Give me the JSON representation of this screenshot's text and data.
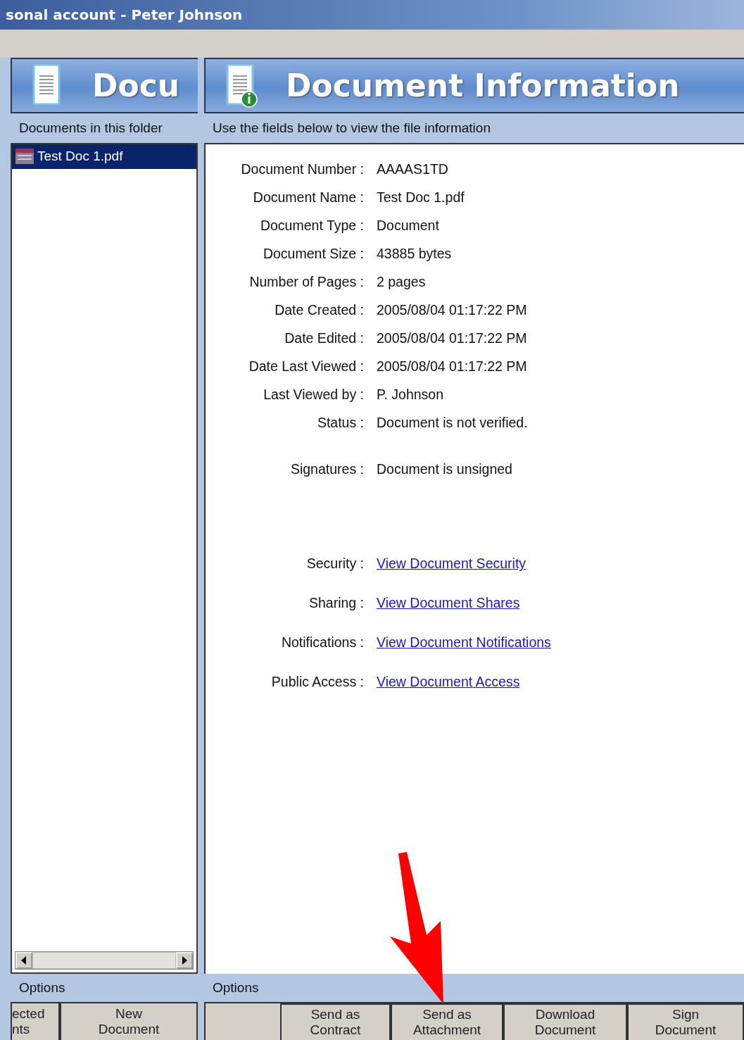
{
  "window": {
    "title": "sonal account - Peter Johnson"
  },
  "left_panel": {
    "header": "Docu",
    "caption": "Documents in this folder",
    "files": [
      {
        "name": "Test Doc 1.pdf",
        "selected": true
      }
    ],
    "options_label": "Options",
    "buttons": [
      {
        "lines": [
          "ected",
          "nts"
        ]
      },
      {
        "lines": [
          "New",
          "Document"
        ]
      }
    ]
  },
  "right_panel": {
    "header": "Document Information",
    "caption": "Use the fields below to view the file information",
    "sections": [
      [
        {
          "label": "Document Number :",
          "value": "AAAAS1TD",
          "kind": "text"
        },
        {
          "label": "Document Name :",
          "value": "Test Doc 1.pdf",
          "kind": "text"
        },
        {
          "label": "Document Type :",
          "value": "Document",
          "kind": "text"
        },
        {
          "label": "Document Size :",
          "value": "43885 bytes",
          "kind": "text"
        },
        {
          "label": "Number of Pages :",
          "value": "2 pages",
          "kind": "text"
        },
        {
          "label": "Date Created :",
          "value": "2005/08/04 01:17:22 PM",
          "kind": "text"
        },
        {
          "label": "Date Edited :",
          "value": "2005/08/04 01:17:22 PM",
          "kind": "text"
        },
        {
          "label": "Date Last Viewed :",
          "value": "2005/08/04 01:17:22 PM",
          "kind": "text"
        },
        {
          "label": "Last Viewed by :",
          "value": "P. Johnson",
          "kind": "text"
        },
        {
          "label": "Status :",
          "value": "Document is not verified.",
          "kind": "text"
        }
      ],
      [
        {
          "label": "Signatures :",
          "value": "Document is unsigned",
          "kind": "text"
        }
      ],
      [
        {
          "label": "Security :",
          "value": "View Document Security",
          "kind": "link"
        },
        {
          "label": "Sharing :",
          "value": "View Document Shares",
          "kind": "link"
        },
        {
          "label": "Notifications :",
          "value": "View Document Notifications",
          "kind": "link"
        },
        {
          "label": "Public Access :",
          "value": "View Document Access",
          "kind": "link"
        }
      ]
    ],
    "options_label": "Options",
    "buttons": [
      {
        "lines": [
          "Send as",
          "Contract"
        ]
      },
      {
        "lines": [
          "Send as",
          "Attachment"
        ]
      },
      {
        "lines": [
          "Download",
          "Document"
        ]
      },
      {
        "lines": [
          "Sign",
          "Document"
        ]
      }
    ]
  }
}
